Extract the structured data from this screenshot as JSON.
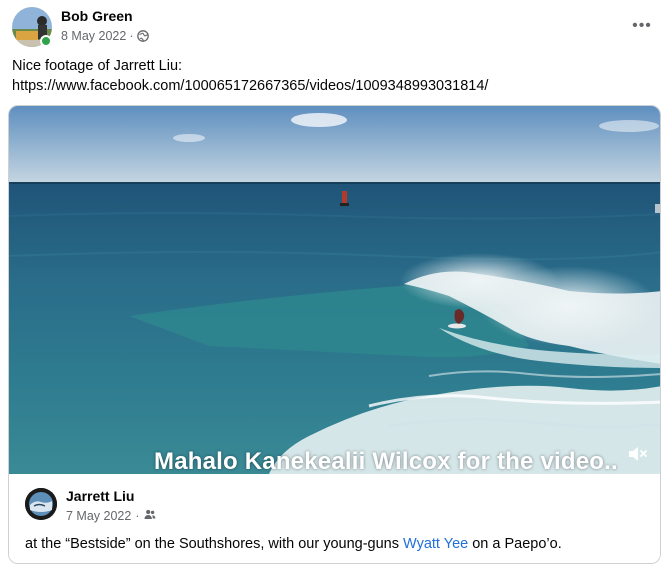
{
  "post": {
    "author": "Bob Green",
    "date": "8 May 2022",
    "separator": "·",
    "audience_icon": "globe-icon",
    "caption": "Nice footage of Jarrett Liu:",
    "link": "https://www.facebook.com/100065172667365/videos/1009348993031814/",
    "more_icon": "more-options-icon",
    "more_label": "•••"
  },
  "shared": {
    "video_overlay_text": "Mahalo Kanekealii Wilcox for the video..",
    "author": "Jarrett Liu",
    "date": "7 May 2022",
    "separator": "·",
    "audience_icon": "friends-icon",
    "text_before": "at the “Bestside” on the Southshores, with our young-guns ",
    "mention": "Wyatt Yee",
    "text_after": " on a Paepo’o."
  },
  "colors": {
    "online": "#31a24c",
    "mention": "#216fdb",
    "secondary_text": "#65676b"
  }
}
